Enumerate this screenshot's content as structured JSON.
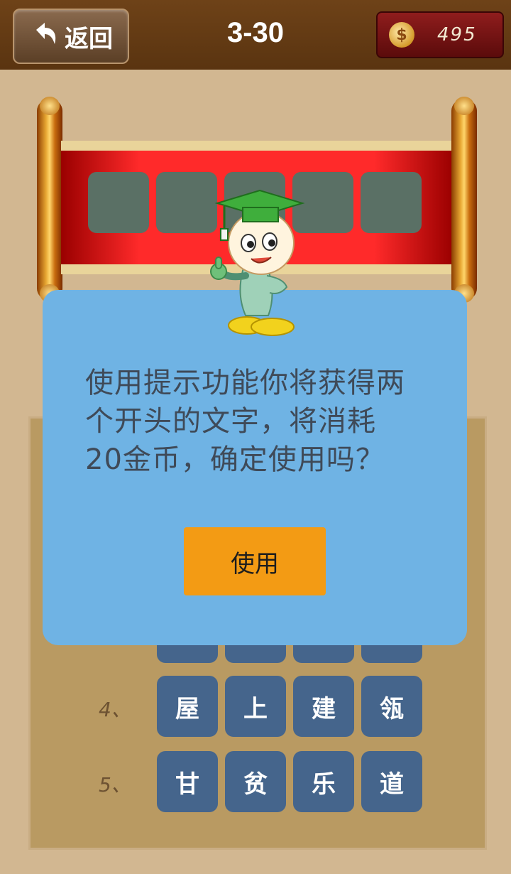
{
  "header": {
    "back_label": "返回",
    "level": "3-30",
    "coins": "495"
  },
  "board": {
    "rows": [
      {
        "number": "4、",
        "chars": [
          "屋",
          "上",
          "建",
          "瓴"
        ]
      },
      {
        "number": "5、",
        "chars": [
          "甘",
          "贫",
          "乐",
          "道"
        ]
      }
    ]
  },
  "dialog": {
    "message": "使用提示功能你将获得两个开头的文字，将消耗20金币，确定使用吗？",
    "use_label": "使用"
  },
  "colors": {
    "background": "#d2b791",
    "tile": "#45658c",
    "dialog": "#6fb3e4",
    "button": "#f39b14"
  }
}
